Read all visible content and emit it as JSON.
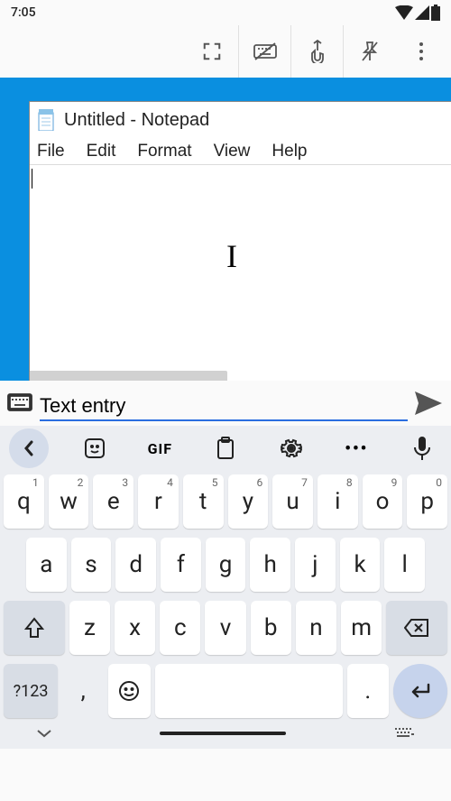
{
  "status": {
    "time": "7:05"
  },
  "notepad": {
    "title": "Untitled - Notepad",
    "menu": {
      "file": "File",
      "edit": "Edit",
      "format": "Format",
      "view": "View",
      "help": "Help"
    }
  },
  "input": {
    "value": "Text entry"
  },
  "kb": {
    "gif": "GIF",
    "row1": {
      "k0": "q",
      "k1": "w",
      "k2": "e",
      "k3": "r",
      "k4": "t",
      "k5": "y",
      "k6": "u",
      "k7": "i",
      "k8": "o",
      "k9": "p",
      "s0": "1",
      "s1": "2",
      "s2": "3",
      "s3": "4",
      "s4": "5",
      "s5": "6",
      "s6": "7",
      "s7": "8",
      "s8": "9",
      "s9": "0"
    },
    "row2": {
      "k0": "a",
      "k1": "s",
      "k2": "d",
      "k3": "f",
      "k4": "g",
      "k5": "h",
      "k6": "j",
      "k7": "k",
      "k8": "l"
    },
    "row3": {
      "k0": "z",
      "k1": "x",
      "k2": "c",
      "k3": "v",
      "k4": "b",
      "k5": "n",
      "k6": "m"
    },
    "sym": "?123",
    "comma": ",",
    "period": "."
  }
}
